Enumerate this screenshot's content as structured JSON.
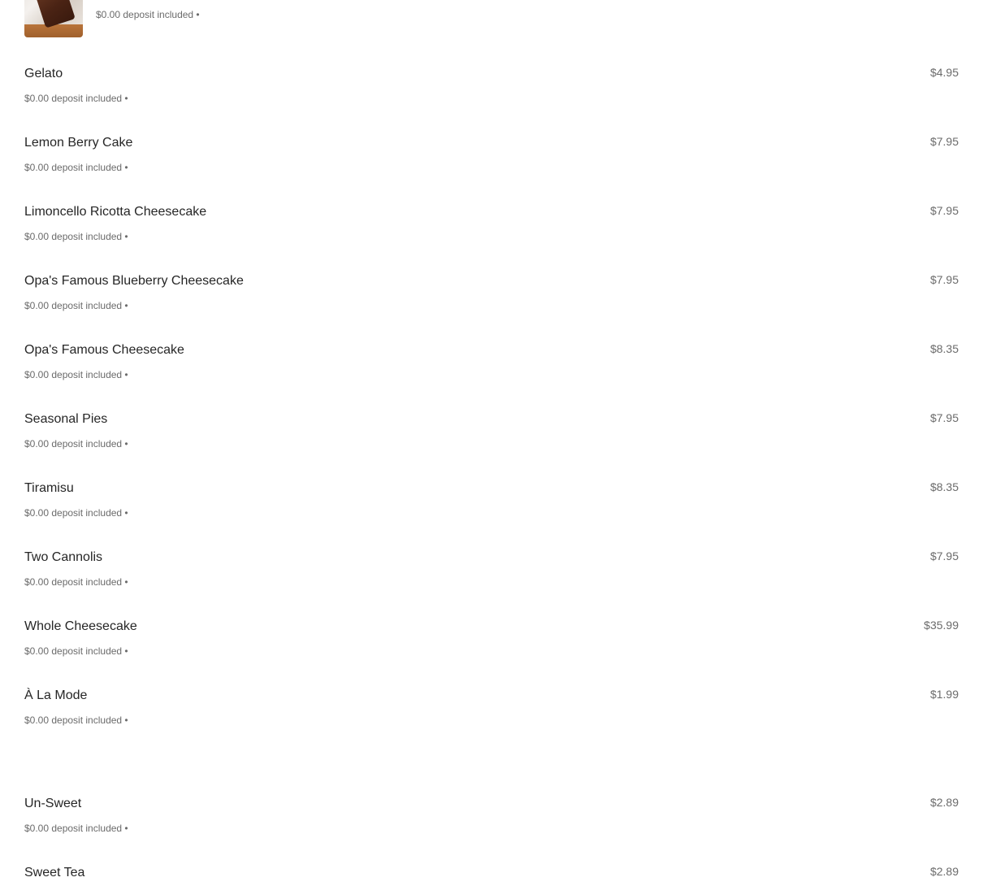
{
  "top_item": {
    "deposit_text": "$0.00 deposit included •"
  },
  "items": [
    {
      "name": "Gelato",
      "deposit": "$0.00 deposit included •",
      "price": "$4.95"
    },
    {
      "name": "Lemon Berry Cake",
      "deposit": "$0.00 deposit included •",
      "price": "$7.95"
    },
    {
      "name": "Limoncello Ricotta Cheesecake",
      "deposit": "$0.00 deposit included •",
      "price": "$7.95"
    },
    {
      "name": "Opa's Famous Blueberry Cheesecake",
      "deposit": "$0.00 deposit included •",
      "price": "$7.95"
    },
    {
      "name": "Opa's Famous Cheesecake",
      "deposit": "$0.00 deposit included •",
      "price": "$8.35"
    },
    {
      "name": "Seasonal Pies",
      "deposit": "$0.00 deposit included •",
      "price": "$7.95"
    },
    {
      "name": "Tiramisu",
      "deposit": "$0.00 deposit included •",
      "price": "$8.35"
    },
    {
      "name": "Two Cannolis",
      "deposit": "$0.00 deposit included •",
      "price": "$7.95"
    },
    {
      "name": "Whole Cheesecake",
      "deposit": "$0.00 deposit included •",
      "price": "$35.99"
    },
    {
      "name": "À La Mode",
      "deposit": "$0.00 deposit included •",
      "price": "$1.99"
    },
    {
      "name": "Un-Sweet",
      "deposit": "$0.00 deposit included •",
      "price": "$2.89"
    },
    {
      "name": "Sweet Tea",
      "deposit": "",
      "price": "$2.89"
    }
  ]
}
